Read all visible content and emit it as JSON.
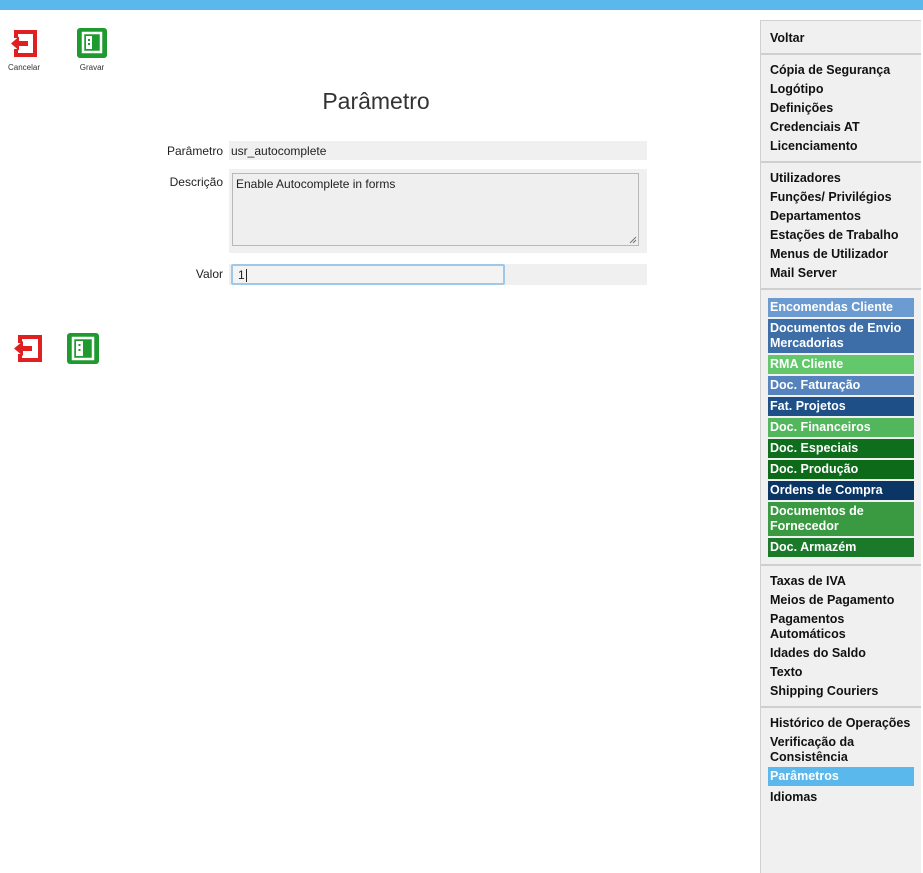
{
  "toolbar": {
    "cancel_label": "Cancelar",
    "save_label": "Gravar"
  },
  "form": {
    "title": "Parâmetro",
    "param_label": "Parâmetro",
    "param_value": "usr_autocomplete",
    "desc_label": "Descrição",
    "desc_value": "Enable Autocomplete in forms",
    "valor_label": "Valor",
    "valor_value": "1"
  },
  "colors": {
    "topbar": "#5bb8ec",
    "cancel_icon": "#e02020",
    "save_icon": "#1f9a2e",
    "selected": "#5bb8ec"
  },
  "sidebar": {
    "group1": [
      {
        "label": "Voltar"
      }
    ],
    "group2": [
      {
        "label": "Cópia de Segurança"
      },
      {
        "label": "Logótipo"
      },
      {
        "label": "Definições"
      },
      {
        "label": "Credenciais AT"
      },
      {
        "label": "Licenciamento"
      }
    ],
    "group3": [
      {
        "label": "Utilizadores"
      },
      {
        "label": "Funções/ Privilégios"
      },
      {
        "label": "Departamentos"
      },
      {
        "label": "Estações de Trabalho"
      },
      {
        "label": "Menus de Utilizador"
      },
      {
        "label": "Mail Server"
      }
    ],
    "group4": [
      {
        "label": "Encomendas Cliente",
        "color": "#6b9bd0"
      },
      {
        "label": "Documentos de Envio Mercadorias",
        "color": "#3d6ea8"
      },
      {
        "label": "RMA Cliente",
        "color": "#63c86b"
      },
      {
        "label": "Doc. Faturação",
        "color": "#5583bd"
      },
      {
        "label": "Fat. Projetos",
        "color": "#1e4f87"
      },
      {
        "label": "Doc. Financeiros",
        "color": "#52b65c"
      },
      {
        "label": "Doc. Especiais",
        "color": "#0f6e1c"
      },
      {
        "label": "Doc. Produção",
        "color": "#0c6a18"
      },
      {
        "label": "Ordens de Compra",
        "color": "#0b3565"
      },
      {
        "label": "Documentos de Fornecedor",
        "color": "#3a9a42"
      },
      {
        "label": "Doc. Armazém",
        "color": "#1b7a2a"
      }
    ],
    "group5": [
      {
        "label": "Taxas de IVA"
      },
      {
        "label": "Meios de Pagamento"
      },
      {
        "label": "Pagamentos Automáticos"
      },
      {
        "label": "Idades do Saldo"
      },
      {
        "label": "Texto"
      },
      {
        "label": "Shipping Couriers"
      }
    ],
    "group6": [
      {
        "label": "Histórico de Operações"
      },
      {
        "label": "Verificação da Consistência"
      },
      {
        "label": "Parâmetros",
        "selected": true
      },
      {
        "label": "Idiomas"
      }
    ]
  }
}
